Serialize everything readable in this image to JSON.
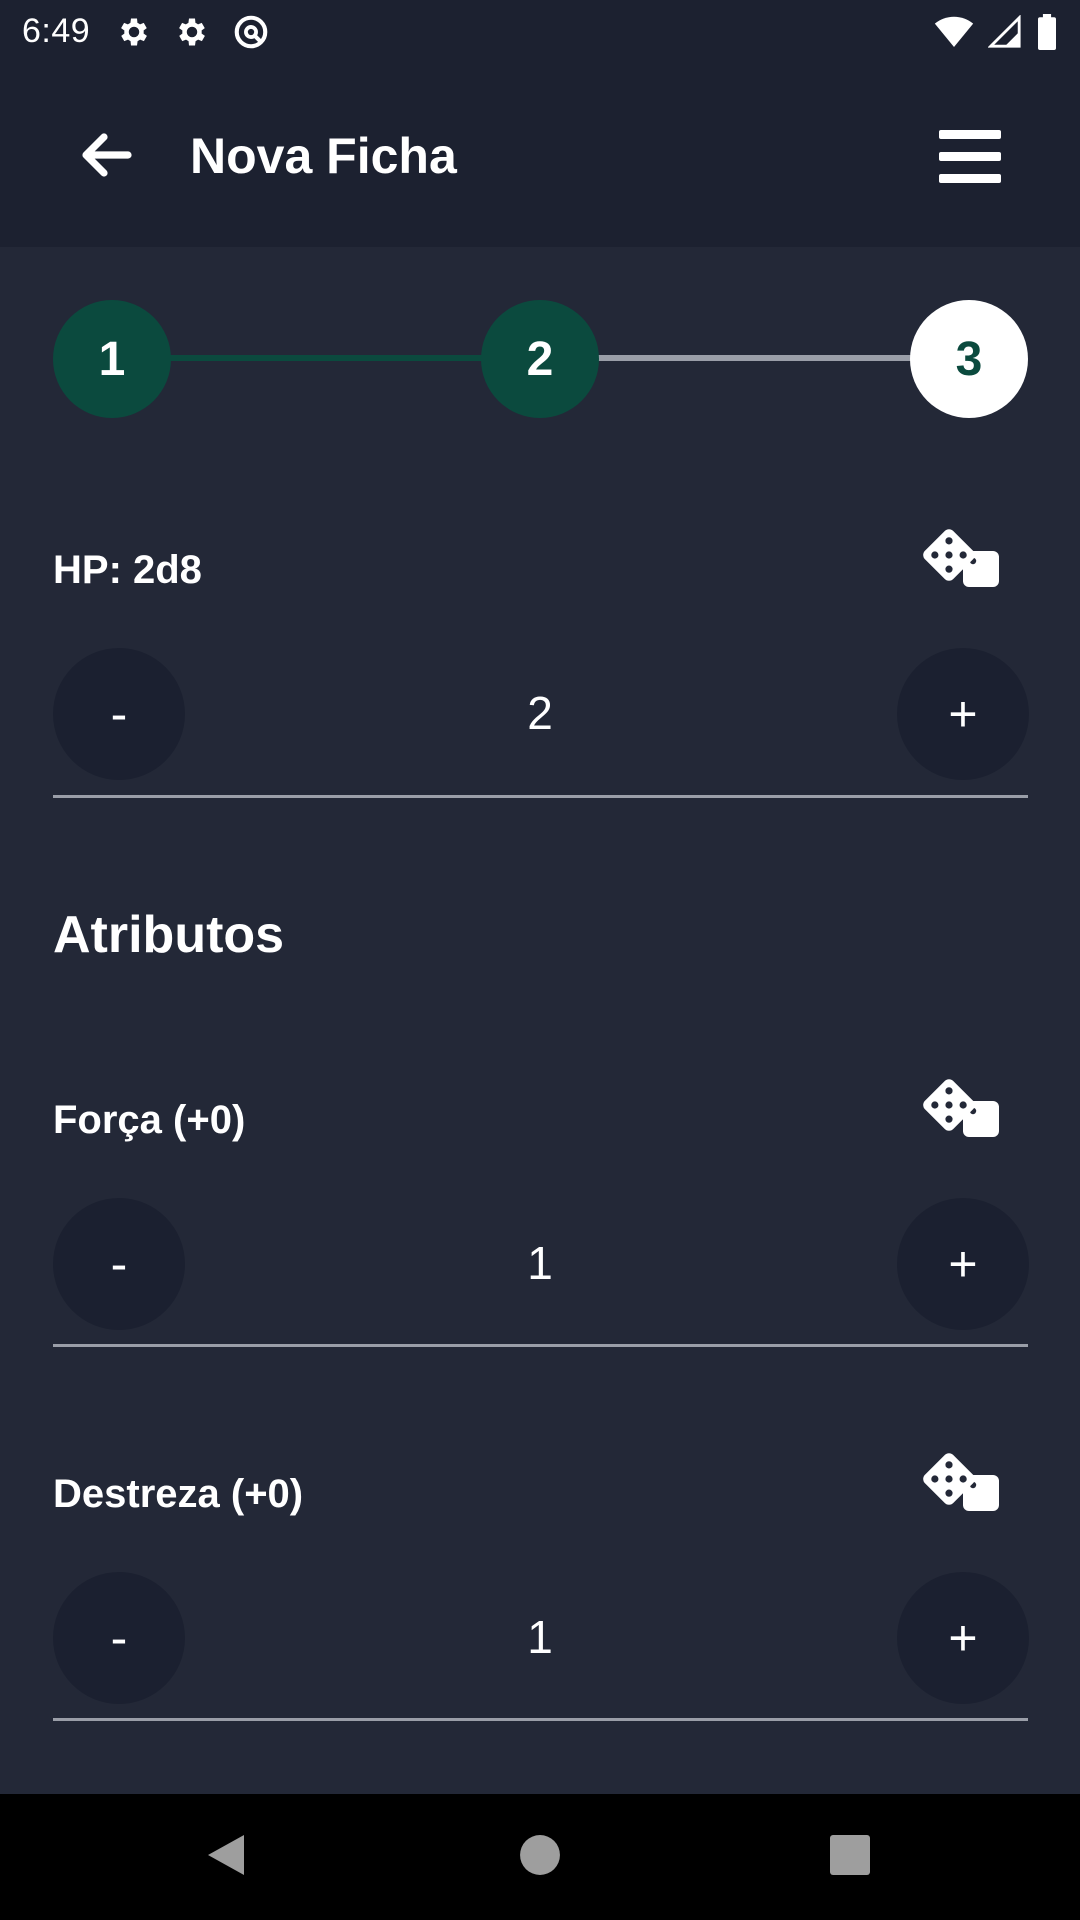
{
  "status_bar": {
    "time": "6:49",
    "left_icons": [
      "gear-icon",
      "gear-icon",
      "vpn-key-icon"
    ],
    "right_icons": [
      "wifi-icon",
      "signal-icon",
      "battery-icon"
    ]
  },
  "app_bar": {
    "title": "Nova Ficha",
    "back_icon": "arrow-left-icon",
    "menu_icon": "hamburger-menu-icon"
  },
  "stepper": {
    "steps": [
      {
        "label": "1",
        "state": "complete"
      },
      {
        "label": "2",
        "state": "complete"
      },
      {
        "label": "3",
        "state": "active"
      }
    ],
    "colors": {
      "complete": "#0b4a3e",
      "active_bg": "#ffffff",
      "active_text": "#0b4a3e",
      "line_inactive": "#9a9ea8"
    }
  },
  "hp": {
    "label": "HP: 2d8",
    "value": "2",
    "minus": "-",
    "plus": "+"
  },
  "attributes": {
    "title": "Atributos",
    "items": [
      {
        "label": "Força (+0)",
        "value": "1",
        "minus": "-",
        "plus": "+"
      },
      {
        "label": "Destreza (+0)",
        "value": "1",
        "minus": "-",
        "plus": "+"
      }
    ]
  },
  "nav_bar": {
    "icons": [
      "back-triangle-icon",
      "home-circle-icon",
      "recents-square-icon"
    ]
  },
  "colors": {
    "background": "#232837",
    "app_bar": "#1c2130",
    "round_button": "#1b2030",
    "accent": "#0b4a3e"
  }
}
